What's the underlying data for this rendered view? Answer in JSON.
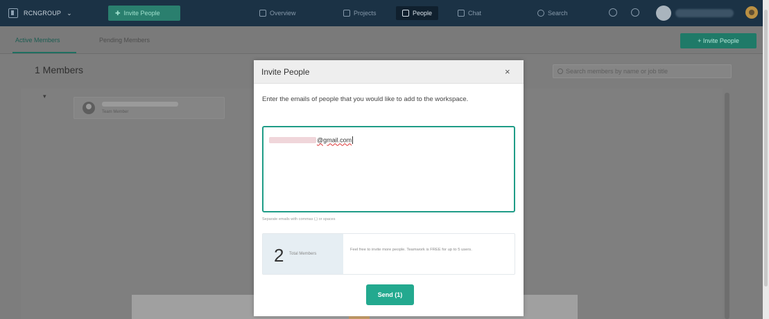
{
  "topbar": {
    "workspace_name": "RCNGROUP",
    "workspace_chevron": "⌄",
    "invite_label": "Invite People",
    "nav": [
      {
        "label": "Overview",
        "icon": "overview-icon"
      },
      {
        "label": "Projects",
        "icon": "projects-icon"
      },
      {
        "label": "People",
        "icon": "people-icon"
      },
      {
        "label": "Chat",
        "icon": "chat-icon"
      }
    ],
    "search_label": "Search",
    "icons": [
      "search-icon",
      "bell-icon"
    ]
  },
  "subtabs": {
    "active_label": "Active Members",
    "pending_label": "Pending Members",
    "invite_button": "+ Invite People"
  },
  "page": {
    "members_title": "1 Members",
    "search_placeholder": "Search members by name or job title",
    "collapse_glyph": "▾",
    "member_role": "Team Member"
  },
  "modal": {
    "title": "Invite People",
    "close_glyph": "×",
    "description": "Enter the emails of people that you would like to add to the workspace.",
    "email_value": "@gmail.com",
    "hint": "Separate emails with commas (,) or spaces",
    "total_count": "2",
    "total_label": "Total Members",
    "info_text": "Feel free to invite more people. Teamwork is FREE for up to 5 users.",
    "send_label": "Send (1)"
  },
  "colors": {
    "nav_bg": "#1b3245",
    "accent": "#23a98f",
    "input_border": "#1f9c87",
    "overlay": "#7d7d7d"
  }
}
